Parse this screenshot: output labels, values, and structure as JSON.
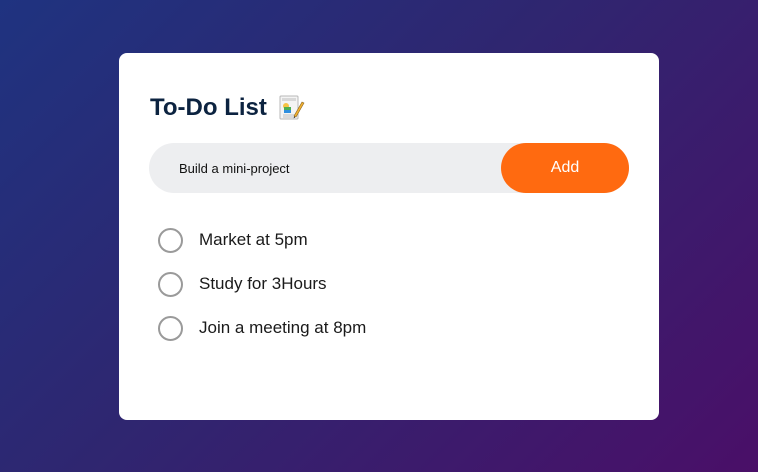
{
  "app": {
    "title": "To-Do List",
    "title_icon": "memo-icon"
  },
  "input": {
    "value": "Build a mini-project",
    "placeholder": ""
  },
  "add_button": {
    "label": "Add"
  },
  "tasks": [
    {
      "text": "Market at 5pm",
      "checked": false
    },
    {
      "text": "Study for 3Hours",
      "checked": false
    },
    {
      "text": "Join a meeting at 8pm",
      "checked": false
    }
  ],
  "colors": {
    "accent": "#ff6a10",
    "title": "#0c2340",
    "background_start": "#1f3380",
    "background_end": "#4a0f68"
  }
}
